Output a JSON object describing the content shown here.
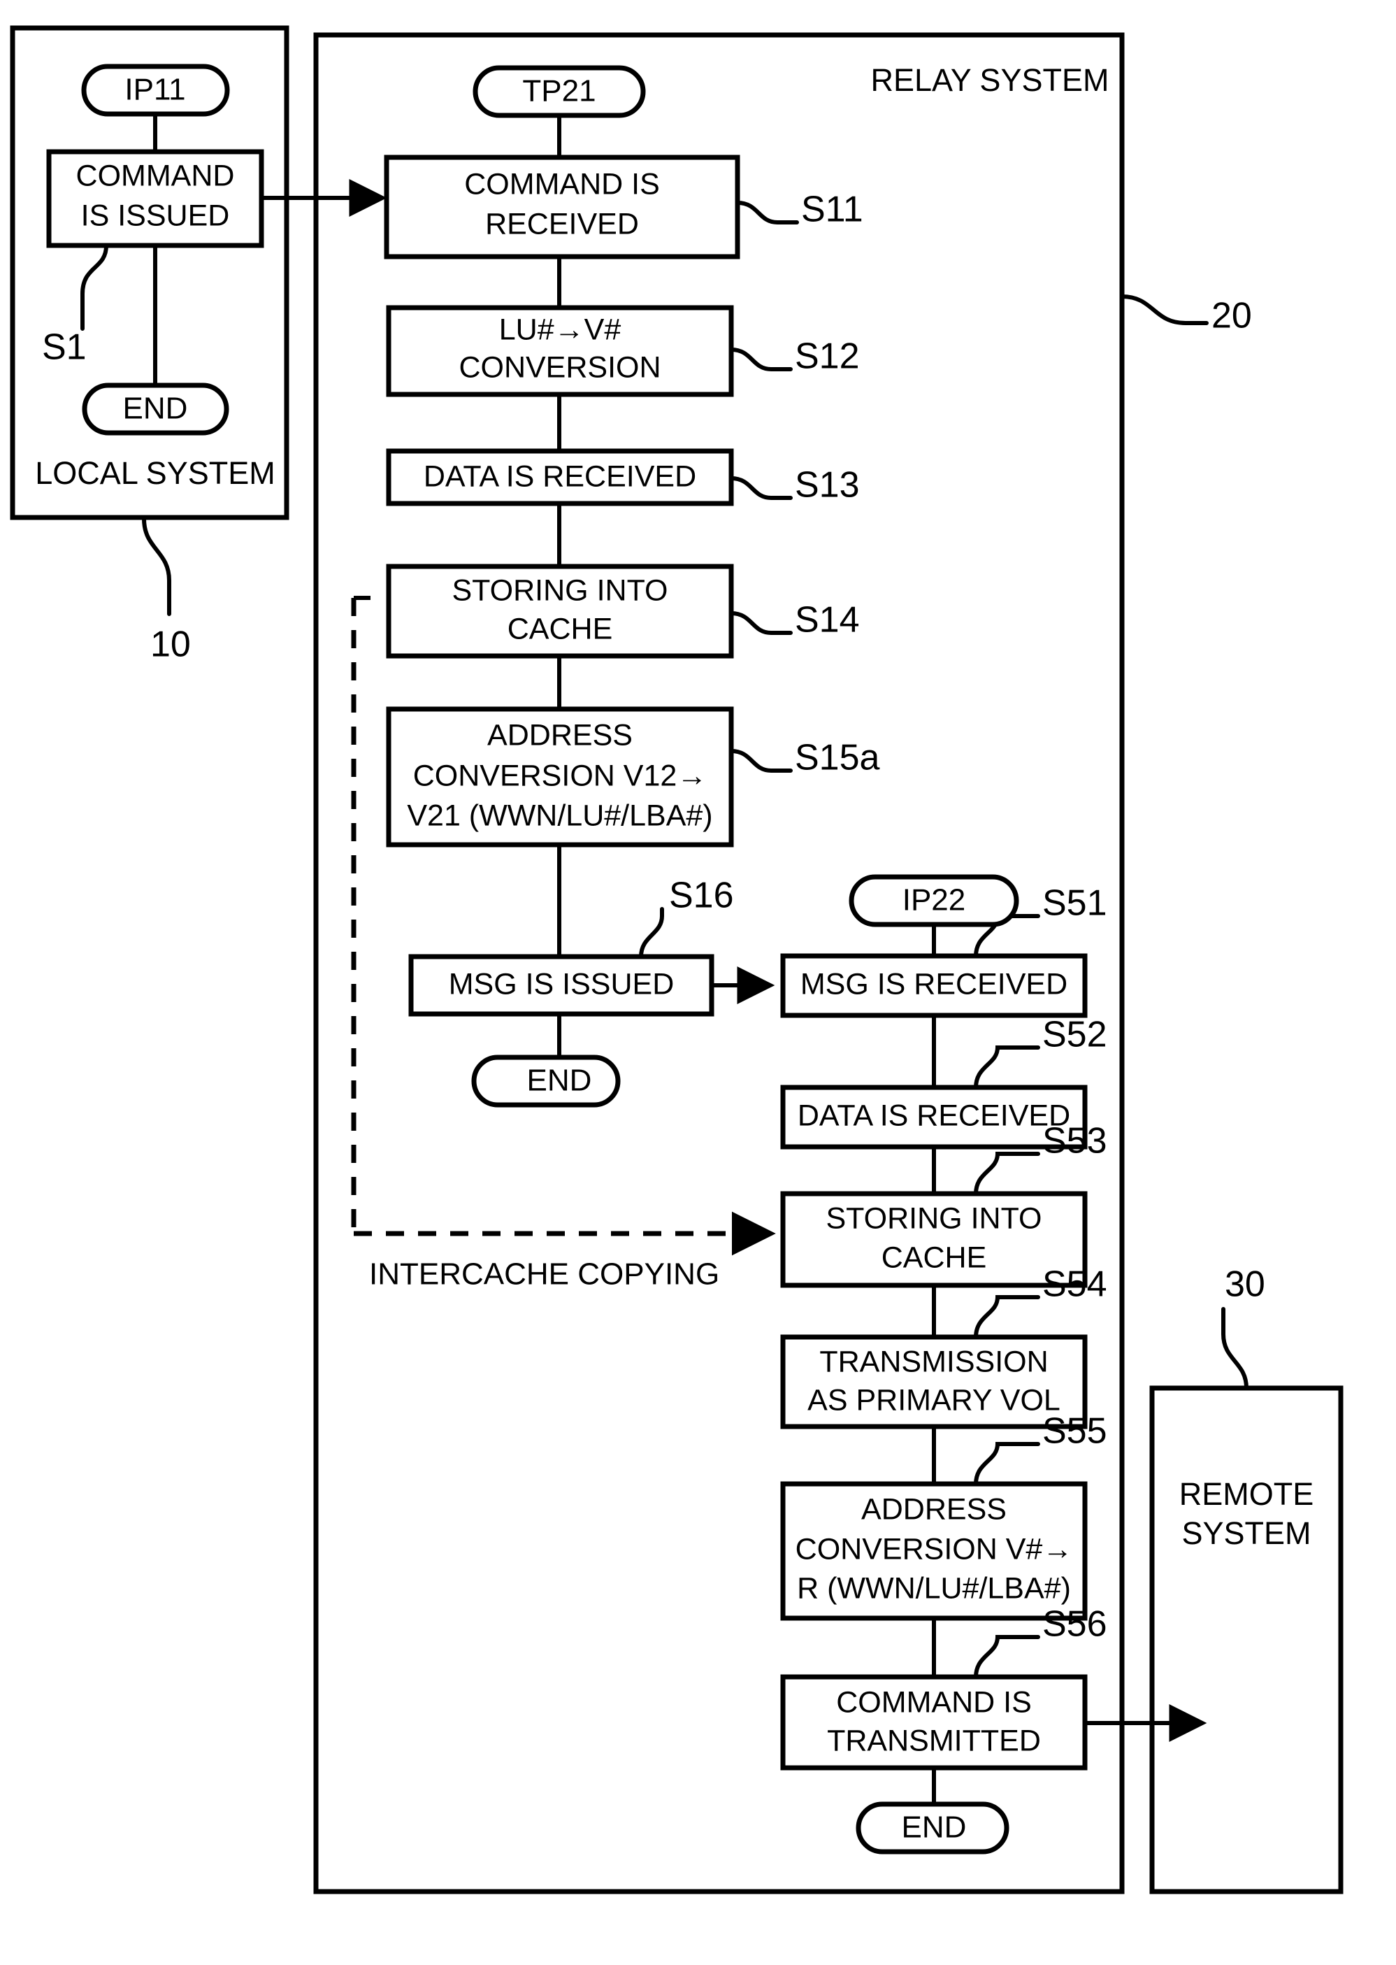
{
  "figure": {
    "containers": [
      {
        "id": "local",
        "label": "LOCAL SYSTEM",
        "ref": "10"
      },
      {
        "id": "relay",
        "label": "RELAY SYSTEM",
        "ref": "20"
      },
      {
        "id": "remote",
        "label": "REMOTE SYSTEM",
        "ref": "30"
      }
    ],
    "terminators": [
      {
        "id": "ip11",
        "label": "IP11"
      },
      {
        "id": "tp21",
        "label": "TP21"
      },
      {
        "id": "ip22",
        "label": "IP22"
      },
      {
        "id": "end_local",
        "label": "END"
      },
      {
        "id": "end_mid",
        "label": "END"
      },
      {
        "id": "end_right",
        "label": "END"
      }
    ],
    "steps": [
      {
        "id": "s1",
        "ref": "S1",
        "lines": [
          "COMMAND",
          "IS ISSUED"
        ]
      },
      {
        "id": "s11",
        "ref": "S11",
        "lines": [
          "COMMAND IS",
          "RECEIVED"
        ]
      },
      {
        "id": "s12",
        "ref": "S12",
        "lines": [
          "LU#→V#",
          "CONVERSION"
        ]
      },
      {
        "id": "s13",
        "ref": "S13",
        "lines": [
          "DATA IS RECEIVED"
        ]
      },
      {
        "id": "s14",
        "ref": "S14",
        "lines": [
          "STORING INTO",
          "CACHE"
        ]
      },
      {
        "id": "s15a",
        "ref": "S15a",
        "lines": [
          "ADDRESS",
          "CONVERSION V12→",
          "V21 (WWN/LU#/LBA#)"
        ]
      },
      {
        "id": "s16",
        "ref": "S16",
        "lines": [
          "MSG IS ISSUED"
        ]
      },
      {
        "id": "s51",
        "ref": "S51",
        "lines": [
          "MSG IS RECEIVED"
        ]
      },
      {
        "id": "s52",
        "ref": "S52",
        "lines": [
          "DATA IS RECEIVED"
        ]
      },
      {
        "id": "s53",
        "ref": "S53",
        "lines": [
          "STORING INTO",
          "CACHE"
        ]
      },
      {
        "id": "s54",
        "ref": "S54",
        "lines": [
          "TRANSMISSION",
          "AS PRIMARY VOL"
        ]
      },
      {
        "id": "s55",
        "ref": "S55",
        "lines": [
          "ADDRESS",
          "CONVERSION V#→",
          "R (WWN/LU#/LBA#)"
        ]
      },
      {
        "id": "s56",
        "ref": "S56",
        "lines": [
          "COMMAND IS",
          "TRANSMITTED"
        ]
      }
    ],
    "annotations": [
      {
        "id": "intercache",
        "label": "INTERCACHE COPYING"
      }
    ],
    "colors": {
      "ink": "#000000",
      "paper": "#ffffff"
    }
  }
}
